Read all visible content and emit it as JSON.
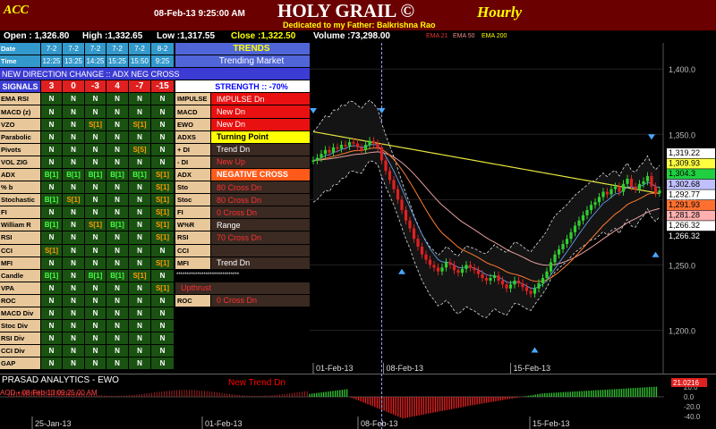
{
  "title_bar": {
    "ticker": "ACC",
    "datetime": "08-Feb-13 9:25:00 AM",
    "app_title": "HOLY GRAIL ©",
    "dedication": "Dedicated to my Father: Balkrishna Rao",
    "timeframe": "Hourly"
  },
  "ohlc": {
    "open": "Open : 1,326.80",
    "high": "High :1,332.65",
    "low": "Low :1,317.55",
    "close": "Close :1,322.50",
    "volume": "Volume :73,298.00",
    "ema_labels": [
      "EMA 21",
      "EMA 50",
      "EMA 200"
    ]
  },
  "panel": {
    "date_label": "Date",
    "time_label": "Time",
    "dates": [
      "7-2",
      "7-2",
      "7-2",
      "7-2",
      "7-2",
      "8-2"
    ],
    "times": [
      "12:25",
      "13:25",
      "14:25",
      "15:25",
      "15:50",
      "9:25"
    ],
    "trends_title": "TRENDS",
    "trends_value": "Trending Market",
    "direction_change": "NEW DIRECTION CHANGE :: ADX NEG CROSS",
    "signals_label": "SIGNALS",
    "signal_values": [
      "3",
      "0",
      "-3",
      "4",
      "-7",
      "-15"
    ],
    "strength": "STRENGTH :: -70%",
    "rows": [
      {
        "label": "EMA RSI",
        "vals": [
          "N",
          "N",
          "N",
          "N",
          "N",
          "N"
        ],
        "rlabel": "IMPULSE",
        "rvalue": "IMPULSE Dn",
        "rclass": "red"
      },
      {
        "label": "MACD (z)",
        "vals": [
          "N",
          "N",
          "N",
          "N",
          "N",
          "N"
        ],
        "rlabel": "MACD",
        "rvalue": "New Dn",
        "rclass": "red"
      },
      {
        "label": "VZO",
        "vals": [
          "N",
          "N",
          "S[1]",
          "N",
          "S[1]",
          "N"
        ],
        "rlabel": "EWO",
        "rvalue": "New Dn",
        "rclass": "red"
      },
      {
        "label": "Parabolic",
        "vals": [
          "N",
          "N",
          "N",
          "N",
          "N",
          "N"
        ],
        "rlabel": "ADXS",
        "rvalue": "Turning Point",
        "rclass": "yellow"
      },
      {
        "label": "Pivots",
        "vals": [
          "N",
          "N",
          "N",
          "N",
          "S[5]",
          "N"
        ],
        "rlabel": "+ DI",
        "rvalue": "Trend Dn",
        "rclass": "white"
      },
      {
        "label": "VOL ZIG",
        "vals": [
          "N",
          "N",
          "N",
          "N",
          "N",
          "N"
        ],
        "rlabel": "- DI",
        "rvalue": "New Up",
        "rclass": "redtext"
      },
      {
        "label": "ADX",
        "vals": [
          "B[1]",
          "B[1]",
          "B[1]",
          "B[1]",
          "B[1]",
          "S[1]"
        ],
        "rlabel": "ADX",
        "rvalue": "NEGATIVE CROSS",
        "rclass": "orange"
      },
      {
        "label": "% b",
        "vals": [
          "N",
          "N",
          "N",
          "N",
          "N",
          "S[1]"
        ],
        "rlabel": "Sto",
        "rvalue": "80 Cross Dn",
        "rclass": "redtext"
      },
      {
        "label": "Stochastic",
        "vals": [
          "B[1]",
          "S[1]",
          "N",
          "N",
          "N",
          "S[1]"
        ],
        "rlabel": "Stoc",
        "rvalue": "80 Cross Dn",
        "rclass": "redtext"
      },
      {
        "label": "FI",
        "vals": [
          "N",
          "N",
          "N",
          "N",
          "N",
          "S[1]"
        ],
        "rlabel": "FI",
        "rvalue": "0 Cross Dn",
        "rclass": "redtext"
      },
      {
        "label": "William R",
        "vals": [
          "B[1]",
          "N",
          "S[1]",
          "B[1]",
          "N",
          "S[1]"
        ],
        "rlabel": "W%R",
        "rvalue": "Range",
        "rclass": "white"
      },
      {
        "label": "RSI",
        "vals": [
          "N",
          "N",
          "N",
          "N",
          "N",
          "S[1]"
        ],
        "rlabel": "RSI",
        "rvalue": "70 Cross Dn",
        "rclass": "redtext"
      },
      {
        "label": "CCI",
        "vals": [
          "S[1]",
          "N",
          "N",
          "N",
          "N",
          "N"
        ],
        "rlabel": "CCI",
        "rvalue": "",
        "rclass": "white"
      },
      {
        "label": "MFI",
        "vals": [
          "N",
          "N",
          "N",
          "N",
          "N",
          "S[1]"
        ],
        "rlabel": "MFI",
        "rvalue": "Trend Dn",
        "rclass": "white"
      },
      {
        "label": "Candle",
        "vals": [
          "B[1]",
          "N",
          "B[1]",
          "B[1]",
          "S[1]",
          "N"
        ],
        "rlabel": "",
        "rvalue": "******************************",
        "rclass": "stars"
      },
      {
        "label": "VPA",
        "vals": [
          "N",
          "N",
          "N",
          "N",
          "N",
          "S[1]"
        ],
        "rlabel": "",
        "rvalue": "Upthrust",
        "rclass": "redwide"
      },
      {
        "label": "ROC",
        "vals": [
          "N",
          "N",
          "N",
          "N",
          "N",
          "N"
        ],
        "rlabel": "ROC",
        "rvalue": "0 Cross Dn",
        "rclass": "redtext"
      },
      {
        "label": "MACD Div",
        "vals": [
          "N",
          "N",
          "N",
          "N",
          "N",
          "N"
        ],
        "rlabel": "",
        "rvalue": "",
        "rclass": "none"
      },
      {
        "label": "Stoc Div",
        "vals": [
          "N",
          "N",
          "N",
          "N",
          "N",
          "N"
        ],
        "rlabel": "",
        "rvalue": "",
        "rclass": "none"
      },
      {
        "label": "RSI Div",
        "vals": [
          "N",
          "N",
          "N",
          "N",
          "N",
          "N"
        ],
        "rlabel": "",
        "rvalue": "",
        "rclass": "none"
      },
      {
        "label": "CCI Div",
        "vals": [
          "N",
          "N",
          "N",
          "N",
          "N",
          "N"
        ],
        "rlabel": "",
        "rvalue": "",
        "rclass": "none"
      },
      {
        "label": "GAP",
        "vals": [
          "N",
          "N",
          "N",
          "N",
          "N",
          "N"
        ],
        "rlabel": "",
        "rvalue": "",
        "rclass": "none"
      }
    ]
  },
  "colors": {
    "title_bg": "#6b0000",
    "green_cell": "#1a5212",
    "label_bg": "#e8c89a",
    "red_cell": "#e81010",
    "price_line": "#ffff40"
  },
  "ewo": {
    "title": "PRASAD ANALYTICS - EWO",
    "signal": "New Trend Dn",
    "aod": "AOD • 08-Feb-13 09:25:00 AM",
    "last_value": "21.0216",
    "yticks": [
      "20.0",
      "0.0",
      "-20.0",
      "-40.0"
    ],
    "xlabels": [
      "25-Jan-13",
      "01-Feb-13",
      "08-Feb-13",
      "15-Feb-13"
    ]
  },
  "chart_data": {
    "type": "line",
    "title": "",
    "y_ticks": [
      1200,
      1250,
      1300,
      1350,
      1400
    ],
    "y_tick_labels": [
      "1,200.0",
      "1,250.0",
      "1,300.0",
      "1,350.0",
      "1,400.0"
    ],
    "ylim": [
      1175,
      1420
    ],
    "x_labels": [
      "01-Feb-13",
      "08-Feb-13",
      "15-Feb-13"
    ],
    "price_labels": [
      {
        "value": 1319.22,
        "text": "1,319.22",
        "bg": "#ffffff",
        "fg": "#000000"
      },
      {
        "value": 1309.93,
        "text": "1,309.93",
        "bg": "#ffff40",
        "fg": "#000000"
      },
      {
        "value": 1304.3,
        "text": "1,304.3",
        "bg": "#20d040",
        "fg": "#000000"
      },
      {
        "value": 1302.68,
        "text": "1,302.68",
        "bg": "#c0c0ff",
        "fg": "#000000"
      },
      {
        "value": 1292.77,
        "text": "1,292.77",
        "bg": "#ffffff",
        "fg": "#000000"
      },
      {
        "value": 1291.93,
        "text": "1,291.93",
        "bg": "#ff7030",
        "fg": "#000000"
      },
      {
        "value": 1281.28,
        "text": "1,281.28",
        "bg": "#ffb0b0",
        "fg": "#000000"
      },
      {
        "value": 1266.32,
        "text": "1,266.32",
        "bg": "#ffffff",
        "fg": "#000000"
      },
      {
        "value": 1266.32,
        "text": "1,266.32",
        "bg": "#000000",
        "fg": "#ffffff"
      }
    ],
    "close": [
      1330,
      1332,
      1335,
      1338,
      1336,
      1340,
      1339,
      1342,
      1341,
      1344,
      1343,
      1340,
      1338,
      1342,
      1345,
      1343,
      1340,
      1330,
      1322,
      1315,
      1308,
      1300,
      1292,
      1284,
      1278,
      1270,
      1264,
      1258,
      1254,
      1250,
      1248,
      1245,
      1248,
      1252,
      1250,
      1246,
      1244,
      1247,
      1250,
      1248,
      1246,
      1243,
      1240,
      1238,
      1240,
      1242,
      1238,
      1235,
      1232,
      1235,
      1238,
      1236,
      1233,
      1230,
      1228,
      1232,
      1236,
      1240,
      1245,
      1252,
      1258,
      1262,
      1266,
      1270,
      1275,
      1280,
      1284,
      1288,
      1292,
      1296,
      1298,
      1302,
      1306,
      1304,
      1308,
      1310,
      1306,
      1312,
      1316,
      1310,
      1308,
      1312,
      1314,
      1318,
      1310,
      1305,
      1307
    ]
  }
}
